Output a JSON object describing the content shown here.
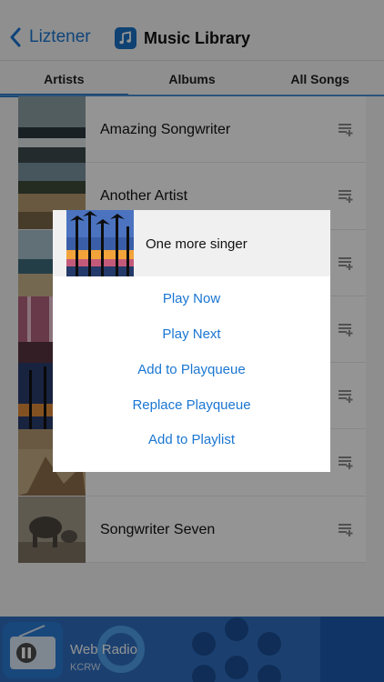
{
  "header": {
    "back_label": "Liztener",
    "title": "Music Library"
  },
  "tabs": [
    {
      "label": "Artists",
      "active": true
    },
    {
      "label": "Albums",
      "active": false
    },
    {
      "label": "All Songs",
      "active": false
    }
  ],
  "artists": [
    {
      "name": "Amazing Songwriter",
      "art": "beach-waves"
    },
    {
      "name": "Another Artist",
      "art": "coastal-trees"
    },
    {
      "name": "",
      "art": "shoreline"
    },
    {
      "name": "",
      "art": "pink-lights"
    },
    {
      "name": "",
      "art": "palm-sunset"
    },
    {
      "name": "",
      "art": "desert-sand"
    },
    {
      "name": "Songwriter Seven",
      "art": "elephants"
    }
  ],
  "modal": {
    "title": "One more singer",
    "actions": [
      "Play Now",
      "Play Next",
      "Add to Playqueue",
      "Replace Playqueue",
      "Add to Playlist"
    ]
  },
  "player": {
    "title": "Web Radio",
    "subtitle": "KCRW",
    "state": "playing"
  },
  "colors": {
    "accent": "#1a76d2",
    "tab_underline": "#1b6fbf",
    "player_bg": "#2c66b6"
  }
}
